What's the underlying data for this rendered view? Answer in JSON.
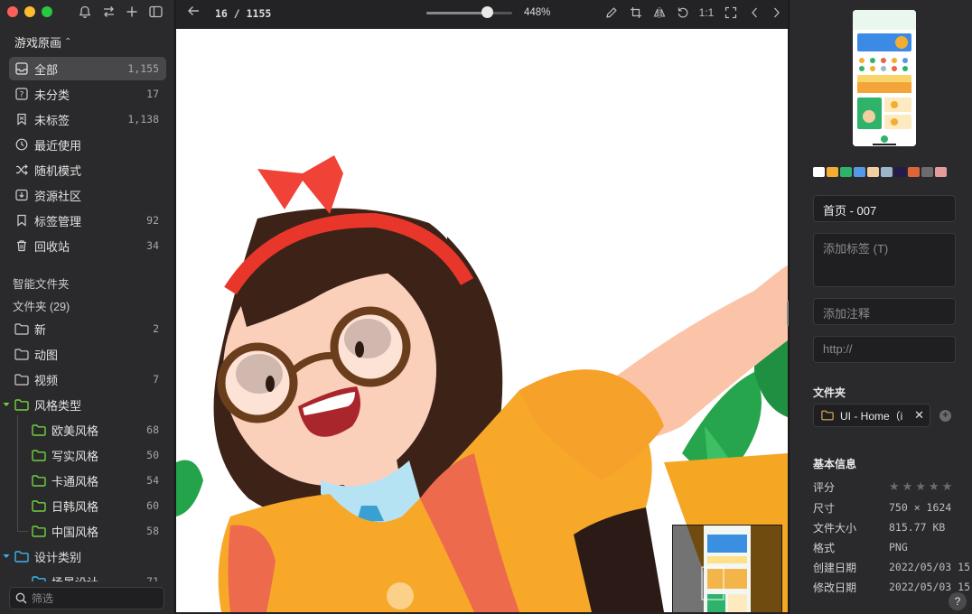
{
  "sidebar": {
    "library_title": "游戏原画",
    "items": [
      {
        "label": "全部",
        "count": "1,155",
        "icon": "inbox-icon",
        "active": true
      },
      {
        "label": "未分类",
        "count": "17",
        "icon": "question-box-icon"
      },
      {
        "label": "未标签",
        "count": "1,138",
        "icon": "untagged-bookmark-icon"
      },
      {
        "label": "最近使用",
        "count": "",
        "icon": "clock-icon"
      },
      {
        "label": "随机模式",
        "count": "",
        "icon": "shuffle-icon"
      },
      {
        "label": "资源社区",
        "count": "",
        "icon": "download-box-icon"
      },
      {
        "label": "标签管理",
        "count": "92",
        "icon": "bookmark-icon"
      },
      {
        "label": "回收站",
        "count": "34",
        "icon": "trash-icon"
      }
    ],
    "smart_folders_label": "智能文件夹",
    "folders_label": "文件夹 (29)",
    "folders": [
      {
        "label": "新",
        "count": "2"
      },
      {
        "label": "动图",
        "count": ""
      },
      {
        "label": "视频",
        "count": "7"
      },
      {
        "label": "风格类型",
        "count": "",
        "color": "#6fd23e"
      },
      {
        "label": "欧美风格",
        "count": "68",
        "color": "#6fd23e"
      },
      {
        "label": "写实风格",
        "count": "50",
        "color": "#6fd23e"
      },
      {
        "label": "卡通风格",
        "count": "54",
        "color": "#6fd23e"
      },
      {
        "label": "日韩风格",
        "count": "60",
        "color": "#6fd23e"
      },
      {
        "label": "中国风格",
        "count": "58",
        "color": "#6fd23e"
      },
      {
        "label": "设计类别",
        "count": "",
        "color": "#3ab4f2"
      },
      {
        "label": "场景设计",
        "count": "71",
        "color": "#3ab4f2"
      }
    ],
    "search_placeholder": "筛选"
  },
  "viewer": {
    "page_indicator": "16 / 1155",
    "zoom_label": "448%",
    "zoom_level": 0.71,
    "one_to_one": "1:1"
  },
  "inspector": {
    "palette": [
      "#ffffff",
      "#f2ad32",
      "#2fb36a",
      "#5599e6",
      "#f2cfa0",
      "#9db6c9",
      "#241b4a",
      "#dd6538",
      "#6c6c70",
      "#e59b9b"
    ],
    "name": "首页 - 007",
    "tags_placeholder": "添加标签 (T)",
    "notes_placeholder": "添加注释",
    "url_placeholder": "http://",
    "folder_heading": "文件夹",
    "folder_chip": "UI - Home（i",
    "basic_info_heading": "基本信息",
    "rating_label": "评分",
    "rating_value": 0,
    "size_label": "尺寸",
    "size_value": "750 × 1624",
    "filesize_label": "文件大小",
    "filesize_value": "815.77 KB",
    "format_label": "格式",
    "format_value": "PNG",
    "created_label": "创建日期",
    "created_value": "2022/05/03 15",
    "modified_label": "修改日期",
    "modified_value": "2022/05/03 15",
    "help": "?"
  }
}
